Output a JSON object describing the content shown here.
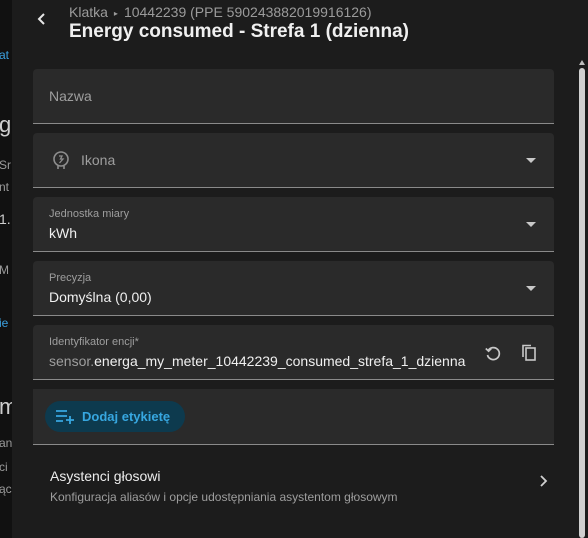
{
  "background": {
    "fragments": [
      "at",
      "g",
      "Sr",
      "nt",
      "1.",
      "M",
      "ie",
      "m",
      "an",
      "ci",
      "ąc"
    ]
  },
  "header": {
    "breadcrumb_device": "Klatka",
    "breadcrumb_separator": "▸",
    "breadcrumb_meter": "10442239 (PPE 590243882019916126)",
    "title": "Energy consumed - Strefa 1 (dzienna)"
  },
  "form": {
    "name_label": "Nazwa",
    "icon_label": "Ikona",
    "unit_label": "Jednostka miary",
    "unit_value": "kWh",
    "precision_label": "Precyzja",
    "precision_value": "Domyślna (0,00)",
    "entity_id_label": "Identyfikator encji*",
    "entity_id_prefix": "sensor.",
    "entity_id_value": "energa_my_meter_10442239_consumed_strefa_1_dzienna",
    "add_label_button": "Dodaj etykietę"
  },
  "voice_assistants": {
    "title": "Asystenci głosowi",
    "description": "Konfiguracja aliasów i opcje udostępniania asystentom głosowym"
  },
  "colors": {
    "accent": "#37a7e0",
    "chip_background": "#0d3a4e",
    "field_background": "#2a2a2a",
    "dialog_background": "#1c1c1c"
  }
}
